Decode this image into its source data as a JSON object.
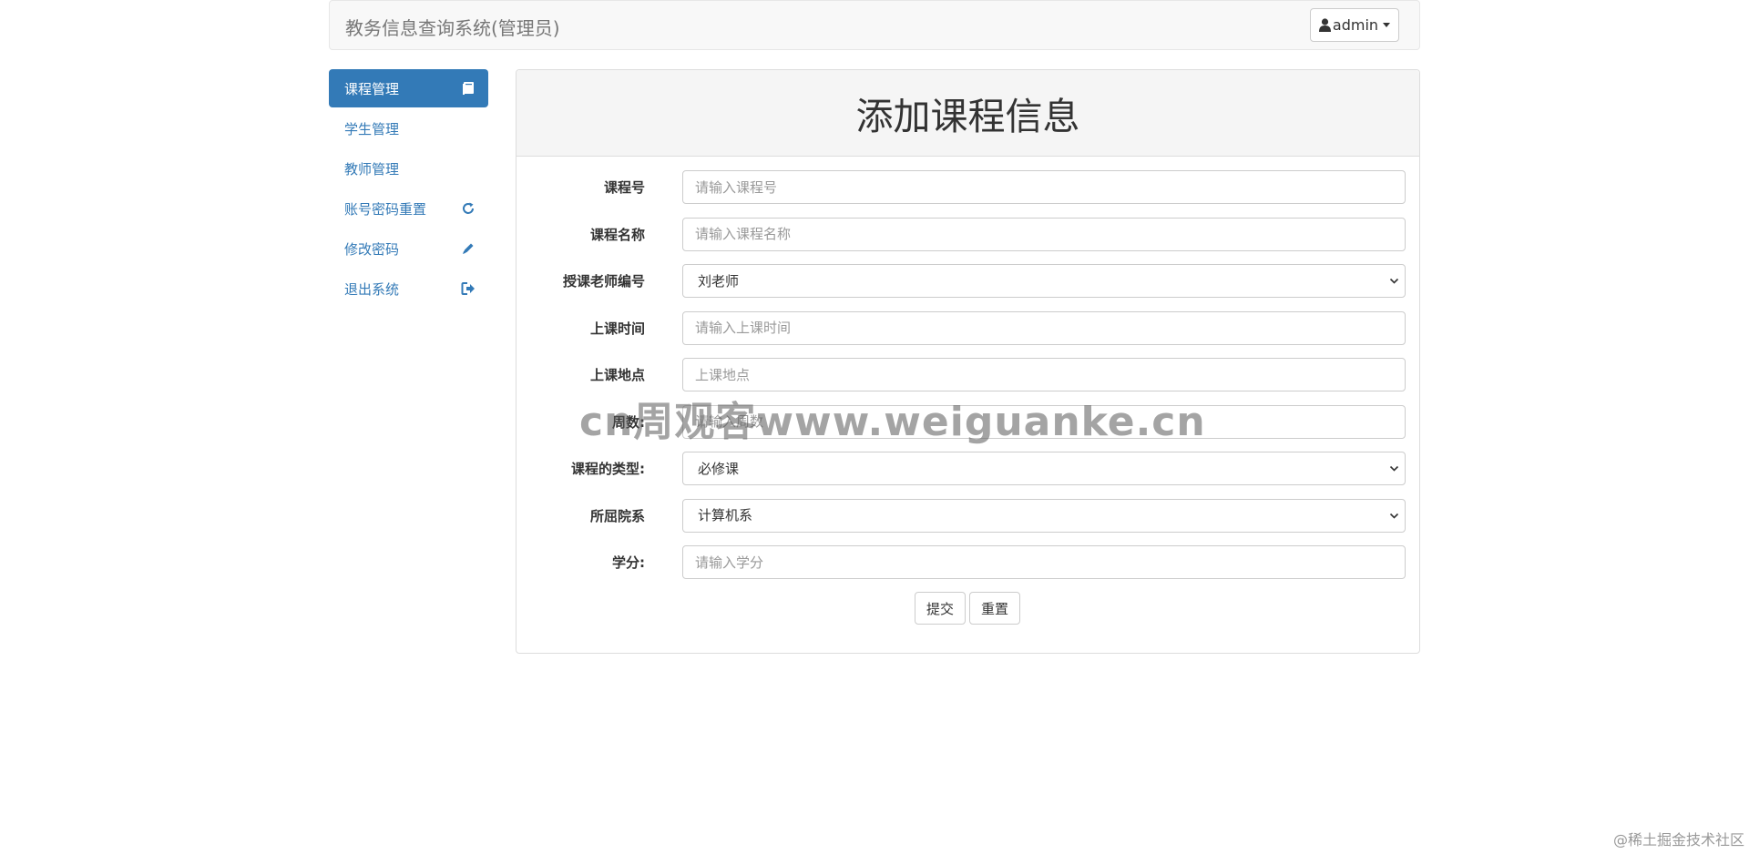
{
  "navbar": {
    "brand": "教务信息查询系统(管理员)",
    "user": "admin",
    "user_icon": "user-icon",
    "caret_icon": "caret-down-icon"
  },
  "sidebar": {
    "items": [
      {
        "label": "课程管理",
        "icon": "book-icon",
        "active": true
      },
      {
        "label": "学生管理",
        "icon": "",
        "active": false
      },
      {
        "label": "教师管理",
        "icon": "",
        "active": false
      },
      {
        "label": "账号密码重置",
        "icon": "refresh-icon",
        "active": false
      },
      {
        "label": "修改密码",
        "icon": "pencil-icon",
        "active": false
      },
      {
        "label": "退出系统",
        "icon": "logout-icon",
        "active": false
      }
    ]
  },
  "panel": {
    "title": "添加课程信息"
  },
  "form": {
    "course_id": {
      "label": "课程号",
      "placeholder": "请输入课程号"
    },
    "course_name": {
      "label": "课程名称",
      "placeholder": "请输入课程名称"
    },
    "teacher": {
      "label": "授课老师编号",
      "value": "刘老师"
    },
    "course_time": {
      "label": "上课时间",
      "placeholder": "请输入上课时间"
    },
    "course_place": {
      "label": "上课地点",
      "placeholder": "上课地点"
    },
    "weeks": {
      "label": "周数:",
      "placeholder": "请输入周数"
    },
    "course_type": {
      "label": "课程的类型:",
      "value": "必修课"
    },
    "department": {
      "label": "所屈院系",
      "value": "计算机系"
    },
    "credit": {
      "label": "学分:",
      "placeholder": "请输入学分"
    }
  },
  "buttons": {
    "submit": "提交",
    "reset": "重置"
  },
  "watermark": "cn周观客www.weiguanke.cn",
  "footer_note": "@稀土掘金技术社区",
  "colors": {
    "accent": "#337ab7",
    "navbar_bg": "#f8f8f8",
    "panel_heading_bg": "#f5f5f5"
  }
}
